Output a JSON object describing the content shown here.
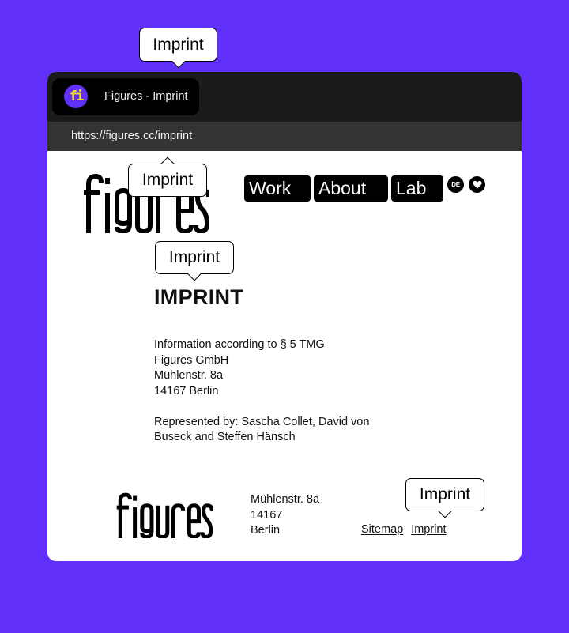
{
  "browser": {
    "tab_title": "Figures - Imprint",
    "favicon_text": "fi",
    "favicon_colors": {
      "background": "#6130fb",
      "glyph": "#f4e01c"
    },
    "url": "https://figures.cc/imprint"
  },
  "theme": {
    "background": "#6130fb",
    "tabbar": "#1b1b1b",
    "urlbar": "#333333"
  },
  "header": {
    "logo_text": "figures",
    "nav": [
      {
        "label": "Work"
      },
      {
        "label": "About"
      },
      {
        "label": "Lab"
      }
    ],
    "lang_button": "DE",
    "favorite_icon": "heart-icon"
  },
  "main": {
    "title": "IMPRINT",
    "info_lines": [
      "Information according to § 5 TMG",
      "Figures GmbH",
      "Mühlenstr. 8a",
      "14167 Berlin"
    ],
    "represented_by": "Represented by: Sascha Collet, David von Buseck and Steffen Hänsch"
  },
  "footer": {
    "logo_text": "figures",
    "address": [
      "Mühlenstr. 8a",
      "14167",
      "Berlin"
    ],
    "links": [
      {
        "label": "Sitemap"
      },
      {
        "label": "Imprint"
      }
    ]
  },
  "tooltips": [
    {
      "text": "Imprint",
      "target": "browser-tab"
    },
    {
      "text": "Imprint",
      "target": "url-bar"
    },
    {
      "text": "Imprint",
      "target": "page-title"
    },
    {
      "text": "Imprint",
      "target": "footer-imprint-link"
    }
  ]
}
